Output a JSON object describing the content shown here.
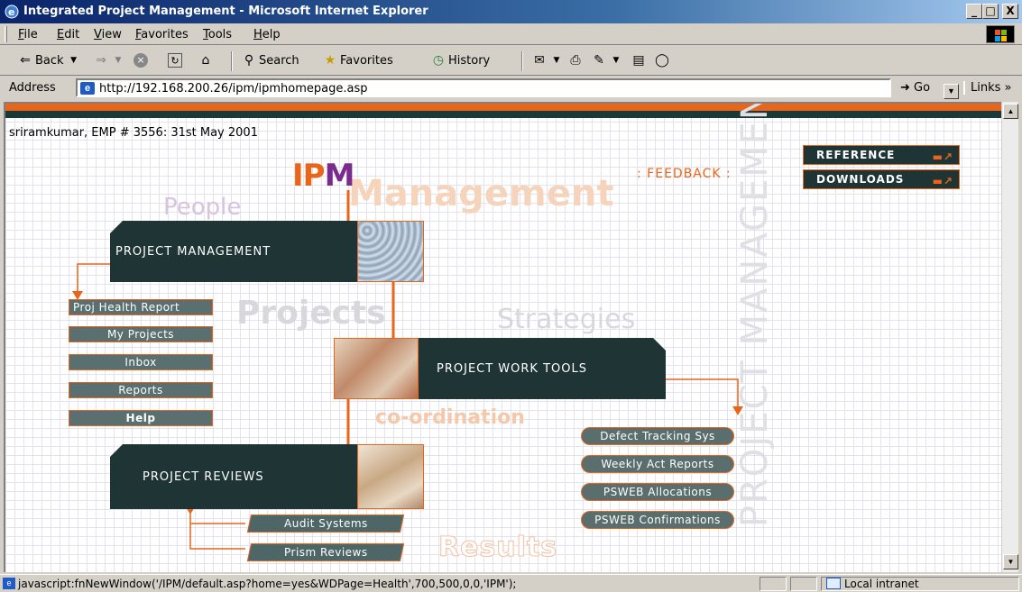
{
  "window": {
    "title": "Integrated Project Management - Microsoft Internet Explorer",
    "min": "_",
    "max": "□",
    "close": "X"
  },
  "menu": [
    "File",
    "Edit",
    "View",
    "Favorites",
    "Tools",
    "Help"
  ],
  "toolbar": {
    "back": "Back",
    "search": "Search",
    "favorites": "Favorites",
    "history": "History"
  },
  "address": {
    "label": "Address",
    "url": "http://192.168.200.26/ipm/ipmhomepage.asp",
    "go": "Go",
    "links": "Links »"
  },
  "page": {
    "user_line": "sriramkumar, EMP # 3556: 31st May 2001",
    "logo": {
      "i": "I",
      "p": "P",
      "m": "M"
    },
    "feedback": ": FEEDBACK :",
    "side_buttons": [
      "REFERENCE",
      "DOWNLOADS"
    ],
    "watermarks": {
      "people": "People",
      "projects": "Projects",
      "strategies": "Strategies",
      "coordination": "co-ordination",
      "results": "Results",
      "management": "Management",
      "vertical": "PROJECT MANAGEMENT"
    },
    "blocks": {
      "pm": "PROJECT MANAGEMENT",
      "tools": "PROJECT WORK TOOLS",
      "reviews": "PROJECT REVIEWS"
    },
    "left_buttons": [
      "Proj Health Report",
      "My Projects",
      "Inbox",
      "Reports",
      "Help"
    ],
    "tool_links": [
      "Defect Tracking Sys",
      "Weekly Act Reports",
      "PSWEB Allocations",
      "PSWEB Confirmations"
    ],
    "review_links": [
      "Audit Systems",
      "Prism Reviews"
    ]
  },
  "status": {
    "text": "javascript:fnNewWindow('/IPM/default.asp?home=yes&WDPage=Health',700,500,0,0,'IPM');",
    "zone": "Local intranet"
  },
  "colors": {
    "accent": "#e8651a",
    "dark": "#1f3535",
    "title_bar": "#0a246a"
  },
  "icons": [
    "ie-icon",
    "back-icon",
    "forward-icon",
    "stop-icon",
    "refresh-icon",
    "home-icon",
    "search-icon",
    "favorites-icon",
    "history-icon",
    "mail-icon",
    "print-icon",
    "edit-icon",
    "discuss-icon",
    "messenger-icon",
    "go-icon",
    "windows-logo-icon",
    "intranet-icon"
  ]
}
